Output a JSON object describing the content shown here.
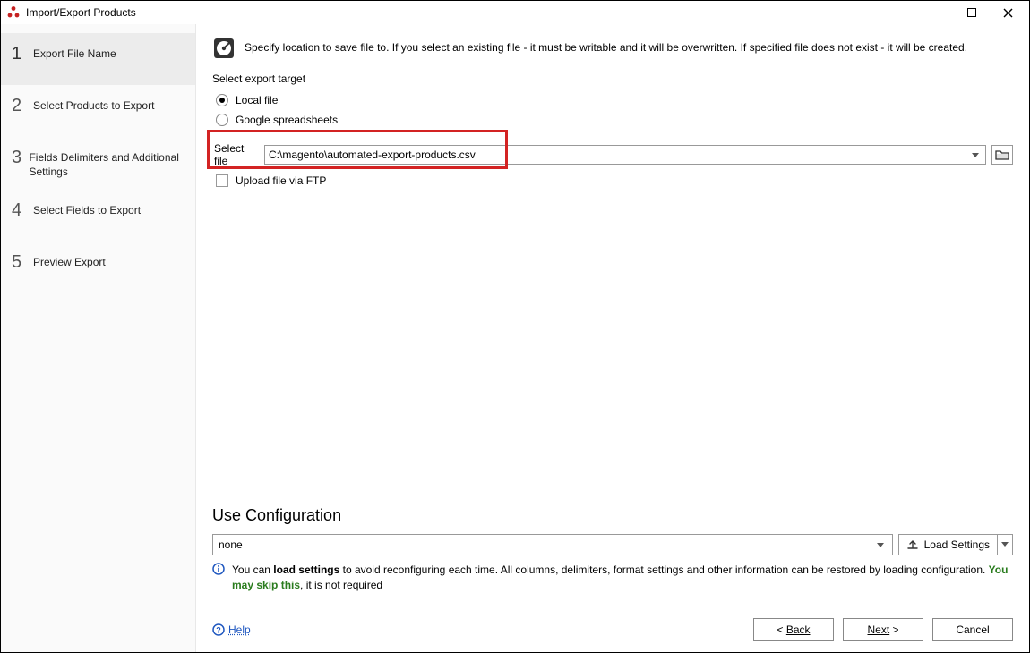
{
  "window": {
    "title": "Import/Export Products"
  },
  "sidebar": {
    "steps": [
      {
        "num": "1",
        "label": "Export File Name"
      },
      {
        "num": "2",
        "label": "Select Products to Export"
      },
      {
        "num": "3",
        "label": "Fields Delimiters and Additional Settings"
      },
      {
        "num": "4",
        "label": "Select Fields to Export"
      },
      {
        "num": "5",
        "label": "Preview Export"
      }
    ],
    "active_index": 0
  },
  "main": {
    "description": "Specify location to save file to. If you select an existing file - it must be writable and it will be overwritten. If specified file does not exist - it will be created.",
    "target_group_label": "Select export target",
    "radio_local": "Local file",
    "radio_google": "Google spreadsheets",
    "selected_radio": "local",
    "select_file_label": "Select file",
    "file_path": "C:\\magento\\automated-export-products.csv",
    "upload_ftp_label": "Upload file via FTP",
    "upload_ftp_checked": false
  },
  "config": {
    "title": "Use Configuration",
    "selected": "none",
    "load_button": "Load Settings",
    "info_pre": "You can ",
    "info_bold1": "load settings",
    "info_mid": " to avoid reconfiguring each time. All columns, delimiters, format settings and other information can be restored by loading configuration. ",
    "info_green": "You may skip this",
    "info_post": ", it is not required"
  },
  "footer": {
    "help": "Help",
    "back": "Back",
    "next": "Next",
    "cancel": "Cancel"
  }
}
